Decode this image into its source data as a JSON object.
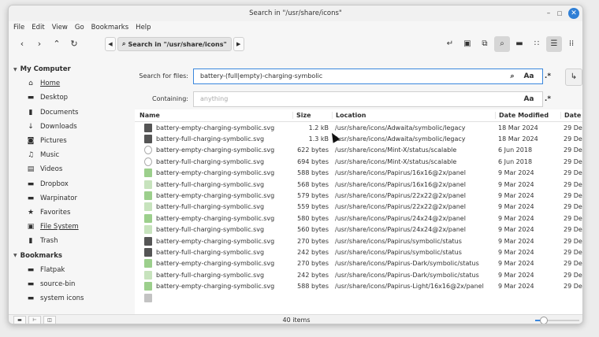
{
  "window": {
    "title": "Search in \"/usr/share/icons\""
  },
  "menu": [
    "File",
    "Edit",
    "View",
    "Go",
    "Bookmarks",
    "Help"
  ],
  "toolbar": {
    "back_icon": "chevron-left",
    "forward_icon": "chevron-right",
    "up_icon": "chevron-up",
    "reload_icon": "reload",
    "path_label": "Search in \"/usr/share/icons\""
  },
  "sidebar": {
    "computer_label": "My Computer",
    "computer_items": [
      {
        "label": "Home",
        "icon": "home"
      },
      {
        "label": "Desktop",
        "icon": "desktop"
      },
      {
        "label": "Documents",
        "icon": "documents"
      },
      {
        "label": "Downloads",
        "icon": "downloads"
      },
      {
        "label": "Pictures",
        "icon": "pictures"
      },
      {
        "label": "Music",
        "icon": "music"
      },
      {
        "label": "Videos",
        "icon": "videos"
      },
      {
        "label": "Dropbox",
        "icon": "folder"
      },
      {
        "label": "Warpinator",
        "icon": "folder"
      },
      {
        "label": "Favorites",
        "icon": "star"
      },
      {
        "label": "File System",
        "icon": "drive"
      },
      {
        "label": "Trash",
        "icon": "trash"
      }
    ],
    "bookmarks_label": "Bookmarks",
    "bookmark_items": [
      {
        "label": "Flatpak",
        "icon": "folder"
      },
      {
        "label": "source-bin",
        "icon": "folder"
      },
      {
        "label": "system icons",
        "icon": "folder"
      }
    ]
  },
  "search": {
    "files_label": "Search for files:",
    "files_value": "battery-(full|empty)-charging-symbolic",
    "containing_label": "Containing:",
    "containing_placeholder": "anything",
    "case_label": "Aa",
    "regex_label": ".*"
  },
  "columns": {
    "name": "Name",
    "size": "Size",
    "location": "Location",
    "modified": "Date Modified",
    "date2": "Date"
  },
  "files": [
    {
      "name": "battery-empty-charging-symbolic.svg",
      "size": "1.2 kB",
      "location": "/usr/share/icons/Adwaita/symbolic/legacy",
      "modified": "18 Mar 2024",
      "date2": "29 De",
      "icon": "dark"
    },
    {
      "name": "battery-full-charging-symbolic.svg",
      "size": "1.3 kB",
      "location": "/usr/share/icons/Adwaita/symbolic/legacy",
      "modified": "18 Mar 2024",
      "date2": "29 De",
      "icon": "dark"
    },
    {
      "name": "battery-empty-charging-symbolic.svg",
      "size": "622 bytes",
      "location": "/usr/share/icons/Mint-X/status/scalable",
      "modified": "6 Jun 2018",
      "date2": "29 De",
      "icon": "outline"
    },
    {
      "name": "battery-full-charging-symbolic.svg",
      "size": "694 bytes",
      "location": "/usr/share/icons/Mint-X/status/scalable",
      "modified": "6 Jun 2018",
      "date2": "29 De",
      "icon": "outline"
    },
    {
      "name": "battery-empty-charging-symbolic.svg",
      "size": "588 bytes",
      "location": "/usr/share/icons/Papirus/16x16@2x/panel",
      "modified": "9 Mar 2024",
      "date2": "29 De",
      "icon": "green"
    },
    {
      "name": "battery-full-charging-symbolic.svg",
      "size": "568 bytes",
      "location": "/usr/share/icons/Papirus/16x16@2x/panel",
      "modified": "9 Mar 2024",
      "date2": "29 De",
      "icon": "lgreen"
    },
    {
      "name": "battery-empty-charging-symbolic.svg",
      "size": "579 bytes",
      "location": "/usr/share/icons/Papirus/22x22@2x/panel",
      "modified": "9 Mar 2024",
      "date2": "29 De",
      "icon": "green"
    },
    {
      "name": "battery-full-charging-symbolic.svg",
      "size": "559 bytes",
      "location": "/usr/share/icons/Papirus/22x22@2x/panel",
      "modified": "9 Mar 2024",
      "date2": "29 De",
      "icon": "lgreen"
    },
    {
      "name": "battery-empty-charging-symbolic.svg",
      "size": "580 bytes",
      "location": "/usr/share/icons/Papirus/24x24@2x/panel",
      "modified": "9 Mar 2024",
      "date2": "29 De",
      "icon": "green"
    },
    {
      "name": "battery-full-charging-symbolic.svg",
      "size": "560 bytes",
      "location": "/usr/share/icons/Papirus/24x24@2x/panel",
      "modified": "9 Mar 2024",
      "date2": "29 De",
      "icon": "lgreen"
    },
    {
      "name": "battery-empty-charging-symbolic.svg",
      "size": "270 bytes",
      "location": "/usr/share/icons/Papirus/symbolic/status",
      "modified": "9 Mar 2024",
      "date2": "29 De",
      "icon": "dark"
    },
    {
      "name": "battery-full-charging-symbolic.svg",
      "size": "242 bytes",
      "location": "/usr/share/icons/Papirus/symbolic/status",
      "modified": "9 Mar 2024",
      "date2": "29 De",
      "icon": "dark"
    },
    {
      "name": "battery-empty-charging-symbolic.svg",
      "size": "270 bytes",
      "location": "/usr/share/icons/Papirus-Dark/symbolic/status",
      "modified": "9 Mar 2024",
      "date2": "29 De",
      "icon": "green"
    },
    {
      "name": "battery-full-charging-symbolic.svg",
      "size": "242 bytes",
      "location": "/usr/share/icons/Papirus-Dark/symbolic/status",
      "modified": "9 Mar 2024",
      "date2": "29 De",
      "icon": "lgreen"
    },
    {
      "name": "battery-empty-charging-symbolic.svg",
      "size": "588 bytes",
      "location": "/usr/share/icons/Papirus-Light/16x16@2x/panel",
      "modified": "9 Mar 2024",
      "date2": "29 De",
      "icon": "green"
    }
  ],
  "status": {
    "text": "40 items",
    "zoom_fraction": 0.2
  }
}
